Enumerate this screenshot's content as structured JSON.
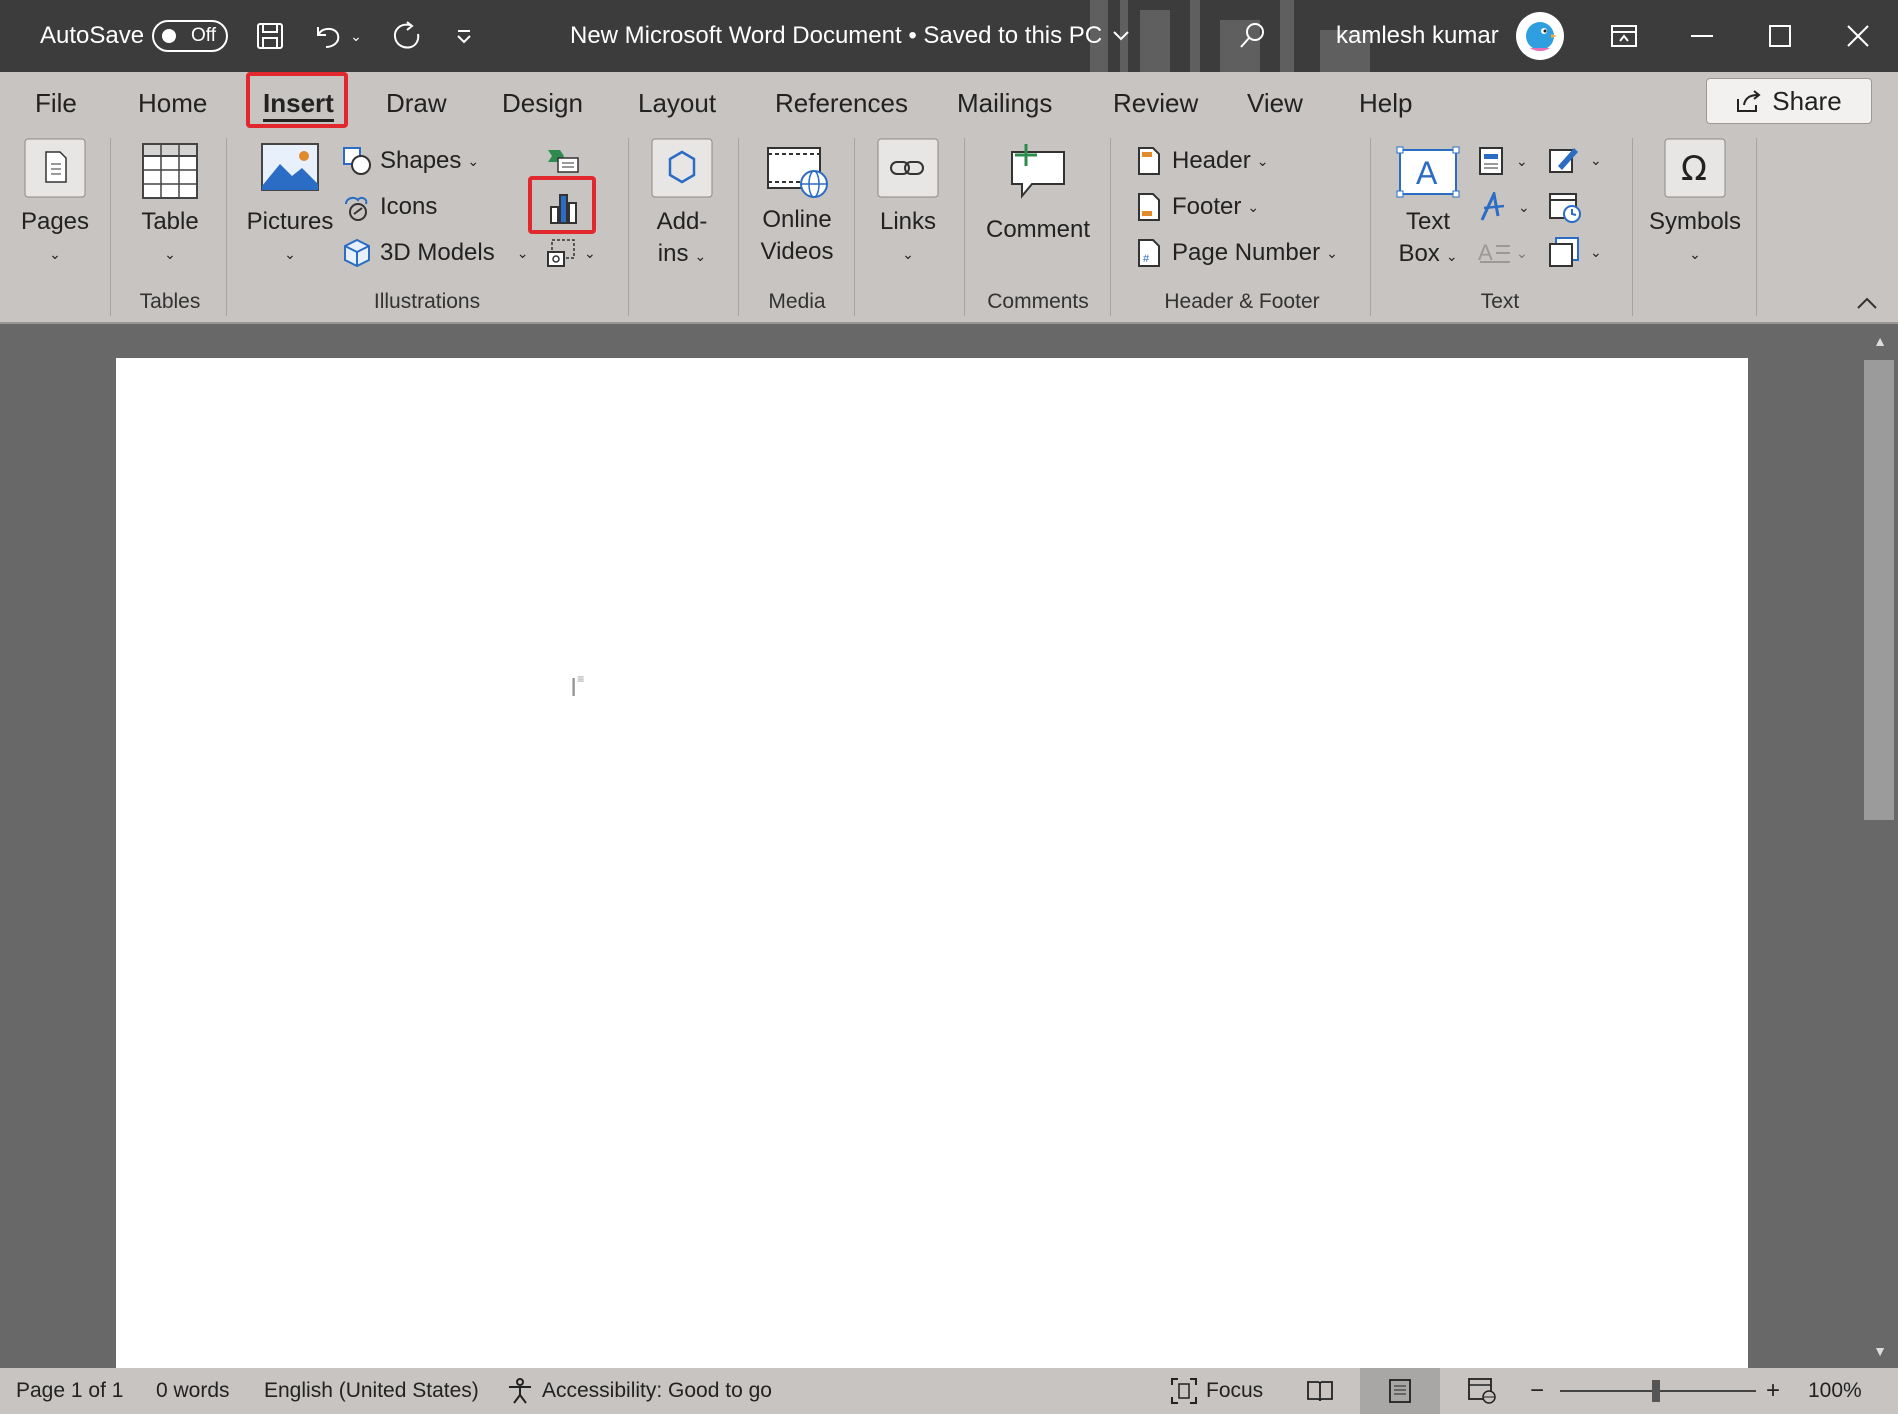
{
  "titlebar": {
    "autosave_label": "AutoSave",
    "autosave_state": "Off",
    "document_title": "New Microsoft Word Document • Saved to this PC",
    "user_name": "kamlesh kumar"
  },
  "tabs": [
    "File",
    "Home",
    "Insert",
    "Draw",
    "Design",
    "Layout",
    "References",
    "Mailings",
    "Review",
    "View",
    "Help"
  ],
  "active_tab": "Insert",
  "share_label": "Share",
  "ribbon": {
    "pages": "Pages",
    "table": "Table",
    "pictures": "Pictures",
    "shapes": "Shapes",
    "icons": "Icons",
    "models3d": "3D Models",
    "addins_line1": "Add-",
    "addins_line2": "ins",
    "online_videos_line1": "Online",
    "online_videos_line2": "Videos",
    "links": "Links",
    "comment": "Comment",
    "header": "Header",
    "footer": "Footer",
    "page_number": "Page Number",
    "textbox_line1": "Text",
    "textbox_line2": "Box",
    "symbols": "Symbols",
    "groups": {
      "tables": "Tables",
      "illustrations": "Illustrations",
      "media": "Media",
      "comments": "Comments",
      "header_footer": "Header & Footer",
      "text": "Text"
    }
  },
  "statusbar": {
    "page": "Page 1 of 1",
    "words": "0 words",
    "language": "English (United States)",
    "accessibility": "Accessibility: Good to go",
    "focus": "Focus",
    "zoom": "100%"
  },
  "colors": {
    "highlight": "#e0282e",
    "ribbon_bg": "#c7c4c1",
    "titlebar_bg": "#3c3c3c",
    "accent_blue": "#2b6cc4"
  }
}
